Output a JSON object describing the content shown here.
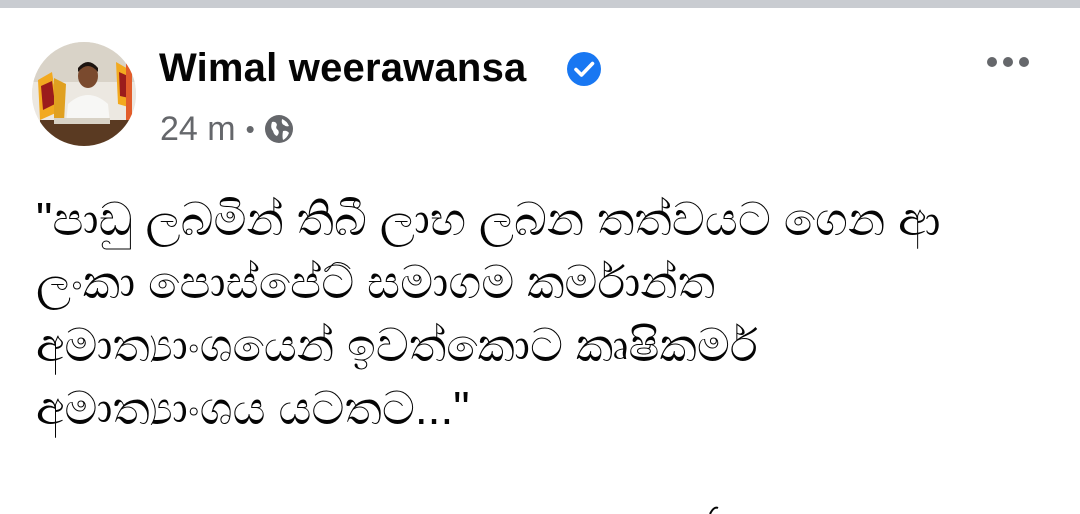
{
  "post": {
    "author": {
      "name": "Wimal weerawansa",
      "verified": true,
      "avatar_icon": "profile-photo"
    },
    "meta": {
      "time": "24 m",
      "separator": "•",
      "audience_icon": "globe-icon"
    },
    "more_icon": "more-options-icon",
    "text": "\"පාඩු ලබමින් තිබී ලාභ ලබන තත්වයට ගෙන ආ\nලංකා පොස්පේට් සමාගම කර්මාන්ත\nඅමාත්‍යාංශයෙන් ඉවත්කොට කෘෂිකර්ම\nඅමාත්‍යාංශය යටතට...\""
  },
  "colors": {
    "text_primary": "#050505",
    "text_secondary": "#65676b",
    "verified_blue": "#1877f2",
    "top_strip": "#c9ccd1"
  }
}
